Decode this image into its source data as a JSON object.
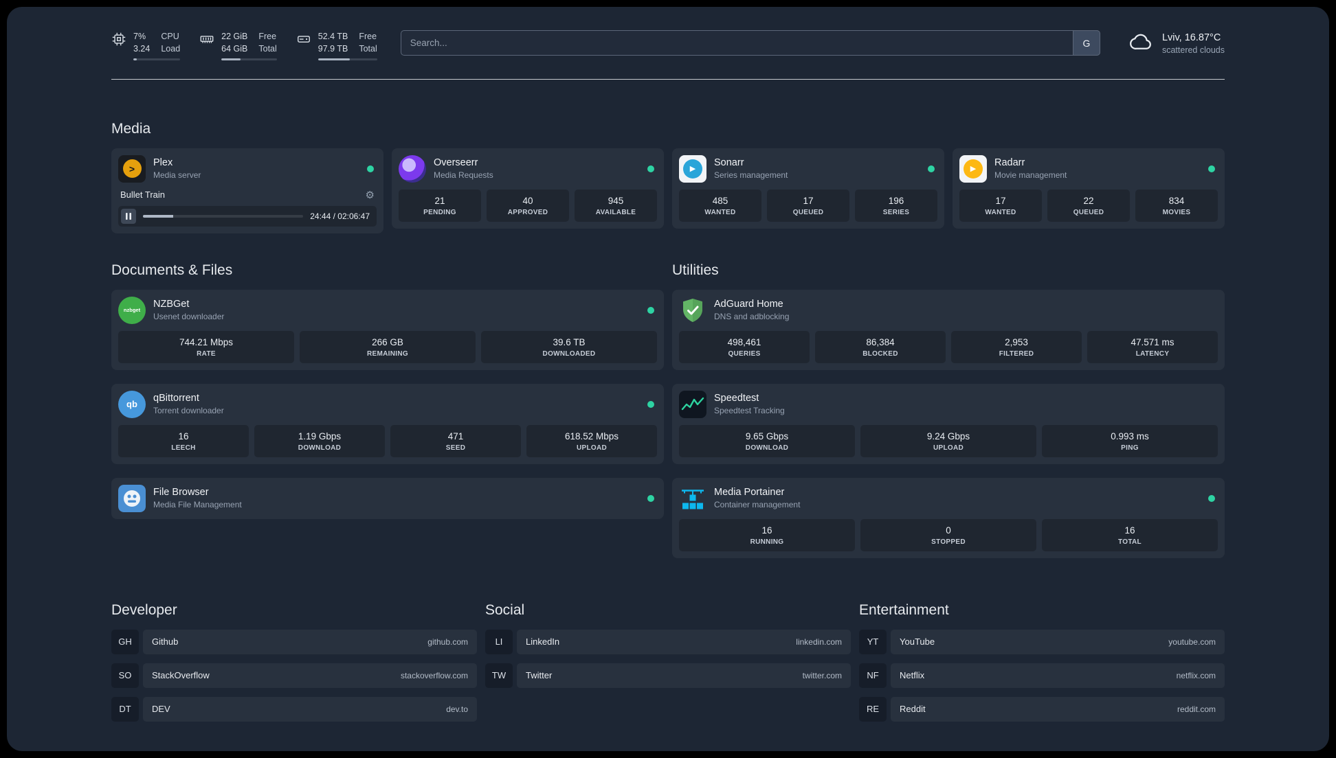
{
  "colors": {
    "status_online": "#2ed3a3",
    "panel_background": "#1d2634",
    "plex_gold": "#e5a00d",
    "portainer_blue": "#0db7ed",
    "adguard_green": "#63b566"
  },
  "icons": {
    "gear": "⚙",
    "plex_chevron": ">",
    "play": "▶",
    "qb_text": "qb",
    "nzbget_text": "nzbget"
  },
  "topbar": {
    "cpu": {
      "value": "7%",
      "sub": "3.24",
      "label_top": "CPU",
      "label_bottom": "Load",
      "bar_pct": 7
    },
    "memory": {
      "value": "22 GiB",
      "sub": "64 GiB",
      "label_top": "Free",
      "label_bottom": "Total",
      "bar_pct": 34
    },
    "disk": {
      "value": "52.4 TB",
      "sub": "97.9 TB",
      "label_top": "Free",
      "label_bottom": "Total",
      "bar_pct": 54
    },
    "search_placeholder": "Search...",
    "search_button": "G",
    "weather": {
      "line1": "Lviv, 16.87°C",
      "line2": "scattered clouds"
    }
  },
  "media": {
    "title": "Media",
    "plex": {
      "name": "Plex",
      "desc": "Media server",
      "online": true,
      "now_playing": "Bullet Train",
      "time": "24:44 / 02:06:47",
      "progress_pct": 19
    },
    "overseerr": {
      "name": "Overseerr",
      "desc": "Media Requests",
      "online": true,
      "stats": [
        {
          "value": "21",
          "label": "PENDING"
        },
        {
          "value": "40",
          "label": "APPROVED"
        },
        {
          "value": "945",
          "label": "AVAILABLE"
        }
      ]
    },
    "sonarr": {
      "name": "Sonarr",
      "desc": "Series management",
      "online": true,
      "stats": [
        {
          "value": "485",
          "label": "WANTED"
        },
        {
          "value": "17",
          "label": "QUEUED"
        },
        {
          "value": "196",
          "label": "SERIES"
        }
      ]
    },
    "radarr": {
      "name": "Radarr",
      "desc": "Movie management",
      "online": true,
      "stats": [
        {
          "value": "17",
          "label": "WANTED"
        },
        {
          "value": "22",
          "label": "QUEUED"
        },
        {
          "value": "834",
          "label": "MOVIES"
        }
      ]
    }
  },
  "documents": {
    "title": "Documents & Files",
    "nzbget": {
      "name": "NZBGet",
      "desc": "Usenet downloader",
      "online": true,
      "stats": [
        {
          "value": "744.21 Mbps",
          "label": "RATE"
        },
        {
          "value": "266 GB",
          "label": "REMAINING"
        },
        {
          "value": "39.6 TB",
          "label": "DOWNLOADED"
        }
      ]
    },
    "qbittorrent": {
      "name": "qBittorrent",
      "desc": "Torrent downloader",
      "online": true,
      "stats": [
        {
          "value": "16",
          "label": "LEECH"
        },
        {
          "value": "1.19 Gbps",
          "label": "DOWNLOAD"
        },
        {
          "value": "471",
          "label": "SEED"
        },
        {
          "value": "618.52 Mbps",
          "label": "UPLOAD"
        }
      ]
    },
    "filebrowser": {
      "name": "File Browser",
      "desc": "Media File Management",
      "online": true
    }
  },
  "utilities": {
    "title": "Utilities",
    "adguard": {
      "name": "AdGuard Home",
      "desc": "DNS and adblocking",
      "stats": [
        {
          "value": "498,461",
          "label": "QUERIES"
        },
        {
          "value": "86,384",
          "label": "BLOCKED"
        },
        {
          "value": "2,953",
          "label": "FILTERED"
        },
        {
          "value": "47.571 ms",
          "label": "LATENCY"
        }
      ]
    },
    "speedtest": {
      "name": "Speedtest",
      "desc": "Speedtest Tracking",
      "stats": [
        {
          "value": "9.65 Gbps",
          "label": "DOWNLOAD"
        },
        {
          "value": "9.24 Gbps",
          "label": "UPLOAD"
        },
        {
          "value": "0.993 ms",
          "label": "PING"
        }
      ]
    },
    "portainer": {
      "name": "Media Portainer",
      "desc": "Container management",
      "online": true,
      "stats": [
        {
          "value": "16",
          "label": "RUNNING"
        },
        {
          "value": "0",
          "label": "STOPPED"
        },
        {
          "value": "16",
          "label": "TOTAL"
        }
      ]
    }
  },
  "bookmarks": {
    "developer": {
      "title": "Developer",
      "items": [
        {
          "abbr": "GH",
          "name": "Github",
          "url": "github.com"
        },
        {
          "abbr": "SO",
          "name": "StackOverflow",
          "url": "stackoverflow.com"
        },
        {
          "abbr": "DT",
          "name": "DEV",
          "url": "dev.to"
        }
      ]
    },
    "social": {
      "title": "Social",
      "items": [
        {
          "abbr": "LI",
          "name": "LinkedIn",
          "url": "linkedin.com"
        },
        {
          "abbr": "TW",
          "name": "Twitter",
          "url": "twitter.com"
        }
      ]
    },
    "entertainment": {
      "title": "Entertainment",
      "items": [
        {
          "abbr": "YT",
          "name": "YouTube",
          "url": "youtube.com"
        },
        {
          "abbr": "NF",
          "name": "Netflix",
          "url": "netflix.com"
        },
        {
          "abbr": "RE",
          "name": "Reddit",
          "url": "reddit.com"
        }
      ]
    }
  }
}
